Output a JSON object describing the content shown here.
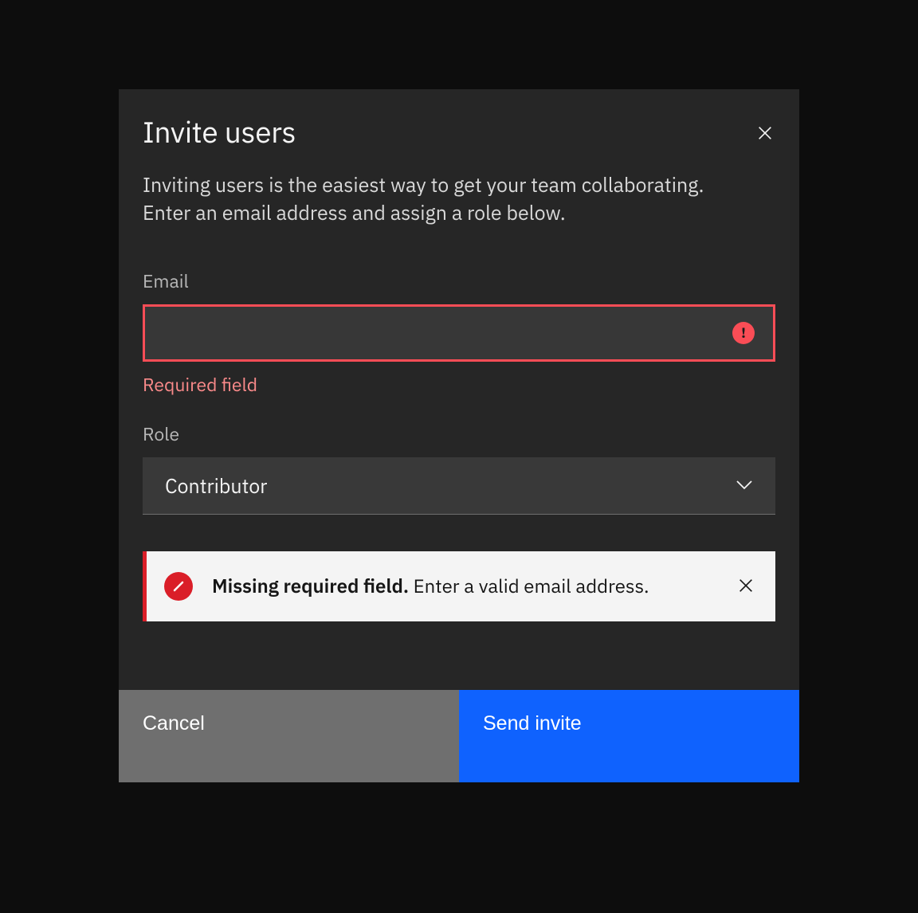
{
  "modal": {
    "title": "Invite users",
    "description": "Inviting users is the easiest way to get your team collaborating. Enter an email address and assign a role below.",
    "form": {
      "email": {
        "label": "Email",
        "value": "",
        "error_text": "Required field"
      },
      "role": {
        "label": "Role",
        "selected": "Contributor"
      }
    },
    "alert": {
      "title": "Missing required field.",
      "message": " Enter a valid email address."
    },
    "buttons": {
      "cancel": "Cancel",
      "submit": "Send invite"
    }
  }
}
